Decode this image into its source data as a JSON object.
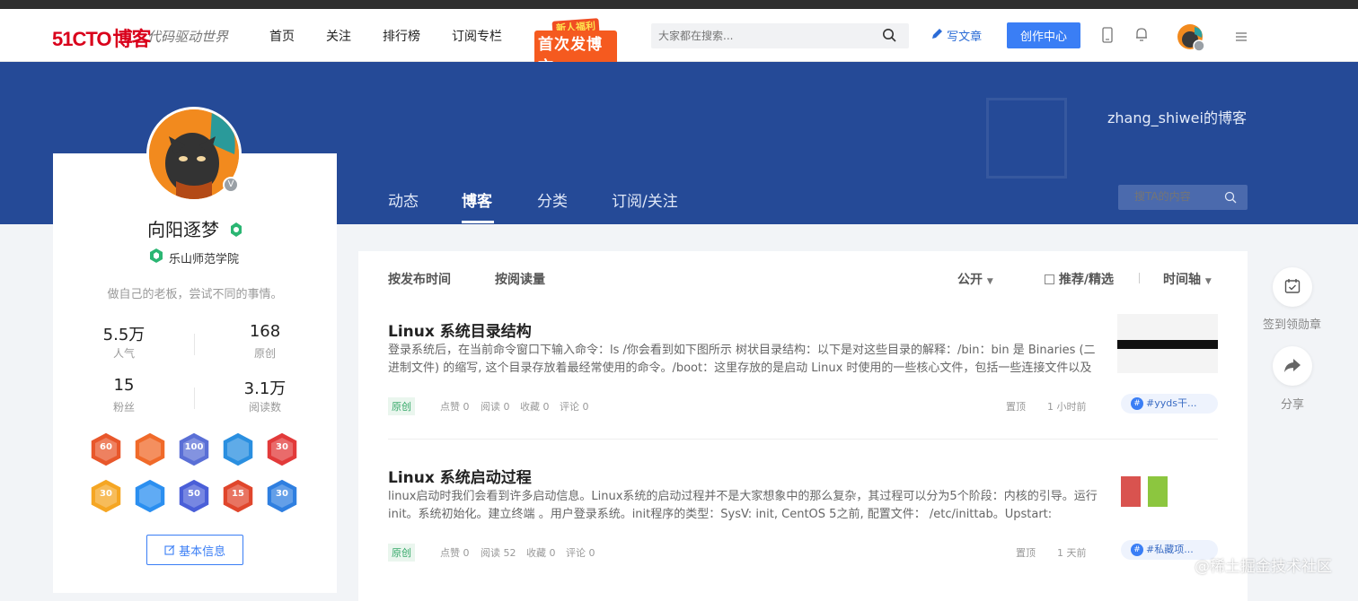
{
  "header": {
    "logo_text": "51CTO",
    "logo_blog": "博客",
    "slogan": "代码驱动世界",
    "nav": [
      "首页",
      "关注",
      "排行榜",
      "订阅专栏"
    ],
    "promo_line1": "新人福利",
    "promo_line2": "首次发博文",
    "search_placeholder": "大家都在搜索...",
    "write_label": "写文章",
    "create_label": "创作中心"
  },
  "banner": {
    "blog_name": "zhang_shiwei的博客",
    "tabs": [
      "动态",
      "博客",
      "分类",
      "订阅/关注"
    ],
    "active_tab": "博客",
    "search_placeholder": "搜TA的内容"
  },
  "profile": {
    "name": "向阳逐梦",
    "school": "乐山师范学院",
    "motto": "做自己的老板，尝试不同的事情。",
    "stats": [
      {
        "value": "5.5万",
        "label": "人气"
      },
      {
        "value": "168",
        "label": "原创"
      },
      {
        "value": "15",
        "label": "粉丝"
      },
      {
        "value": "3.1万",
        "label": "阅读数"
      }
    ],
    "medals": [
      {
        "text": "60",
        "color": "#e8572b"
      },
      {
        "text": "",
        "color": "#f06a2a"
      },
      {
        "text": "100",
        "color": "#5a6fd6"
      },
      {
        "text": "",
        "color": "#2a8fe0"
      },
      {
        "text": "30",
        "color": "#e23a3a"
      },
      {
        "text": "30",
        "color": "#f5a623"
      },
      {
        "text": "",
        "color": "#2b8ff0"
      },
      {
        "text": "50",
        "color": "#4a5fd8"
      },
      {
        "text": "15",
        "color": "#e0462c"
      },
      {
        "text": "30",
        "color": "#2f7fe0"
      }
    ],
    "basic_info_label": "基本信息"
  },
  "filters": {
    "by_time": "按发布时间",
    "by_reads": "按阅读量",
    "visibility": "公开",
    "recommend": "推荐/精选",
    "timeline": "时间轴"
  },
  "articles": [
    {
      "title": "Linux 系统目录结构",
      "summary": "登录系统后，在当前命令窗口下输入命令：ls /你会看到如下图所示 树状目录结构：以下是对这些目录的解释：/bin：bin 是 Binaries (二进制文件) 的缩写, 这个目录存放着最经常使用的命令。/boot：这里存放的是启动 Linux 时使用的一些核心文件，包括一些连接文件以及",
      "badge": "原创",
      "likes": "点赞  0",
      "reads": "阅读  0",
      "favs": "收藏  0",
      "comments": "评论  0",
      "pin": "置顶",
      "time": "1 小时前",
      "tag": "#yyds干..."
    },
    {
      "title": "Linux 系统启动过程",
      "summary": "linux启动时我们会看到许多启动信息。Linux系统的启动过程并不是大家想象中的那么复杂，其过程可以分为5个阶段：内核的引导。运行 init。系统初始化。建立终端 。用户登录系统。init程序的类型：SysV: init, CentOS 5之前, 配置文件： /etc/inittab。Upstart:",
      "badge": "原创",
      "likes": "点赞  0",
      "reads": "阅读  52",
      "favs": "收藏  0",
      "comments": "评论  0",
      "pin": "置顶",
      "time": "1 天前",
      "tag": "#私藏项..."
    }
  ],
  "side": {
    "checkin_label": "签到领勋章",
    "share_label": "分享"
  },
  "watermark": "@稀土掘金技术社区"
}
